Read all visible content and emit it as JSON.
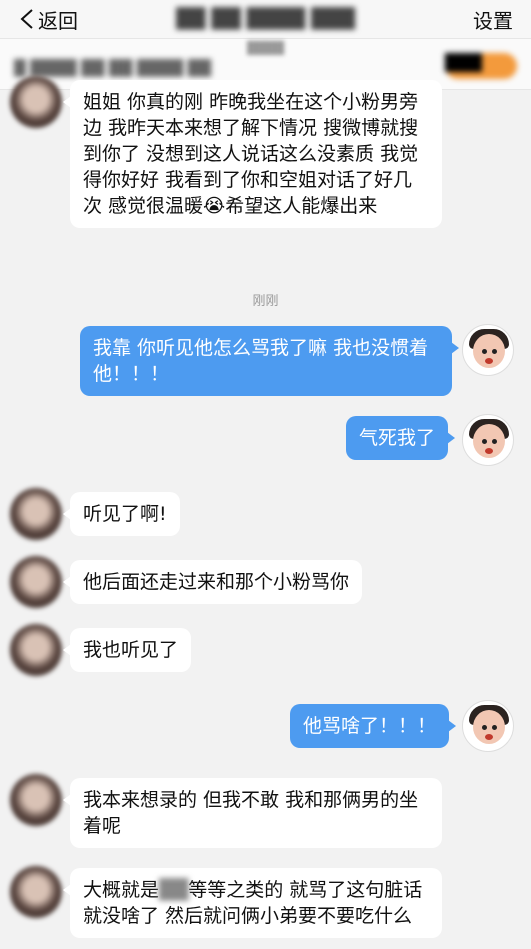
{
  "navbar": {
    "back_label": "返回",
    "title": "██ ██ ████ ███",
    "settings_label": "设置"
  },
  "info_strip": {
    "sub_text": "████",
    "text": "█ ████ ██ ██ ████ ██",
    "badge": "███"
  },
  "messages": [
    {
      "side": "left",
      "text": "姐姐 你真的刚 昨晚我坐在这个小粉男旁边 我昨天本来想了解下情况 搜微博就搜到你了 没想到这人说话这么没素质 我觉得你好好 我看到了你和空姐对话了好几次 感觉很温暖😭希望这人能爆出来"
    },
    {
      "side": "right",
      "text": "我靠 你听见他怎么骂我了嘛 我也没惯着他！！！"
    },
    {
      "side": "right",
      "text": "气死我了"
    },
    {
      "side": "left",
      "text": "听见了啊!"
    },
    {
      "side": "left",
      "text": "他后面还走过来和那个小粉骂你"
    },
    {
      "side": "left",
      "text": "我也听见了"
    },
    {
      "side": "right",
      "text": "他骂啥了！！！"
    },
    {
      "side": "left",
      "text": "我本来想录的 但我不敢 我和那俩男的坐着呢"
    },
    {
      "side": "left",
      "text_before": "大概就是",
      "text_blurred": "██",
      "text_after": "等等之类的 就骂了这句脏话 就没啥了 然后就问俩小弟要不要吃什么"
    }
  ],
  "timestamp": "刚刚"
}
